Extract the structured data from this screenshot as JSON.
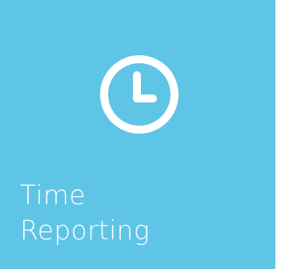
{
  "tile": {
    "label_line1": "Time",
    "label_line2": "Reporting",
    "icon": "clock-icon",
    "background_color": "#5fc5e6",
    "foreground_color": "#ffffff"
  }
}
